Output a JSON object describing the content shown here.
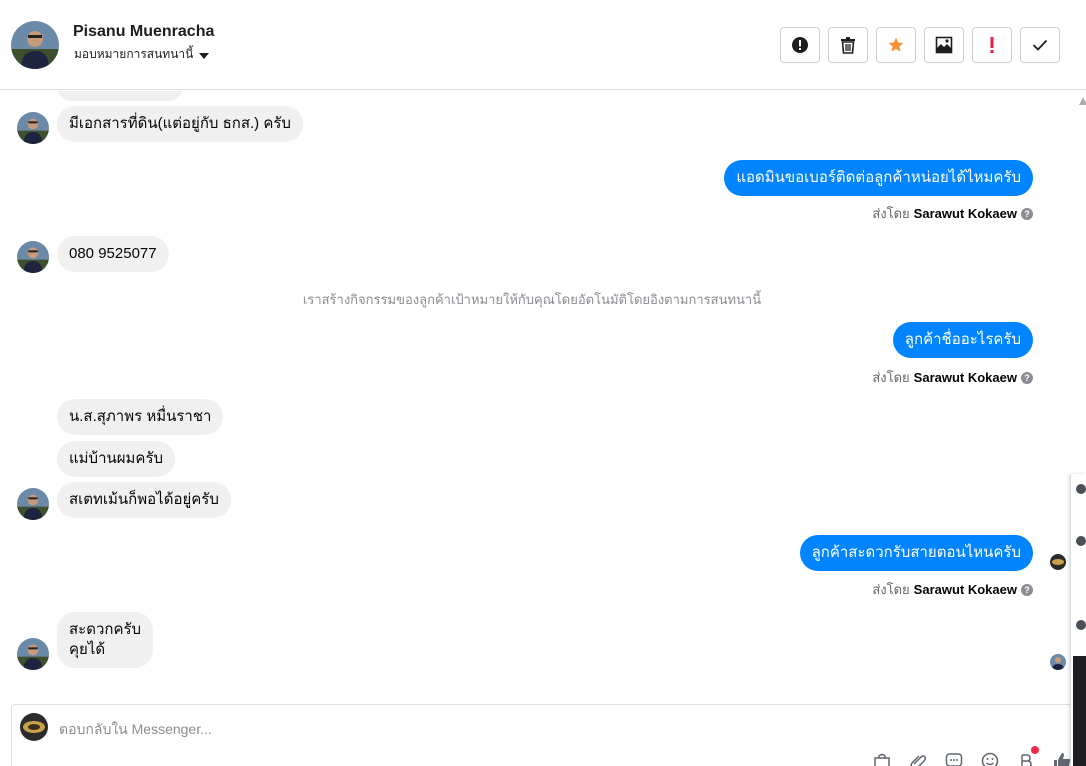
{
  "header": {
    "name": "Pisanu Muenracha",
    "assign_label": "มอบหมายการสนทนานี้",
    "toolbar": [
      {
        "icon": "alert-circle-icon",
        "color": "#1c1e21"
      },
      {
        "icon": "trash-icon",
        "color": "#1c1e21"
      },
      {
        "icon": "star-icon",
        "color": "#f7923b"
      },
      {
        "icon": "archive-inbox-icon",
        "color": "#1c1e21"
      },
      {
        "icon": "spam-exclamation-icon",
        "color": "#e41e3f"
      },
      {
        "icon": "checkmark-icon",
        "color": "#1c1e21"
      }
    ]
  },
  "messages": {
    "in_1": "มีเอกสารที่ดิน(แต่อยู่กับ ธกส.) ครับ",
    "out_1": "แอดมินขอเบอร์ติดต่อลูกค้าหน่อยได้ไหมครับ",
    "sent_by_prefix": "ส่งโดย",
    "sent_by_name": "Sarawut Kokaew",
    "in_2": "080 9525077",
    "system_note": "เราสร้างกิจกรรมของลูกค้าเป้าหมายให้กับคุณโดยอัตโนมัติโดยอิงตามการสนทนานี้",
    "out_2": "ลูกค้าชื่ออะไรครับ",
    "in_3": "น.ส.สุภาพร หมื่นราชา",
    "in_4": "แม่บ้านผมครับ",
    "in_5": "สเตทเม้นก็พอได้อยู่ครับ",
    "out_3": "ลูกค้าสะดวกรับสายตอนไหนครับ",
    "in_6_line1": "สะดวกครับ",
    "in_6_line2": "คุยได้"
  },
  "composer": {
    "placeholder": "ตอบกลับใน Messenger...",
    "tools": [
      "shopping-bag-icon",
      "paperclip-icon",
      "saved-reply-icon",
      "emoji-icon",
      "payment-icon",
      "like-icon"
    ]
  },
  "colors": {
    "outgoing_bubble": "#0084ff",
    "incoming_bubble": "#f0f0f0",
    "notification_dot": "#f02849"
  }
}
